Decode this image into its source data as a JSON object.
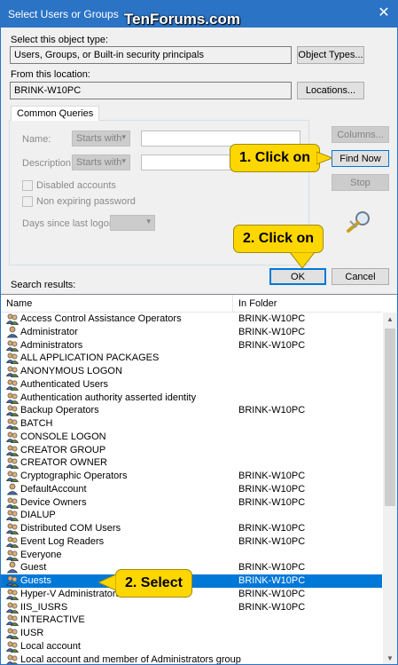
{
  "window": {
    "title": "Select Users or Groups",
    "watermark": "TenForums.com",
    "close_glyph": "✕"
  },
  "object_type": {
    "label": "Select this object type:",
    "value": "Users, Groups, or Built-in security principals",
    "button": "Object Types..."
  },
  "location": {
    "label": "From this location:",
    "value": "BRINK-W10PC",
    "button": "Locations..."
  },
  "queries": {
    "tab": "Common Queries",
    "name_label": "Name:",
    "name_mode": "Starts with",
    "description_label": "Description:",
    "description_mode": "Starts with",
    "disabled_accounts": "Disabled accounts",
    "non_expiring_password": "Non expiring password",
    "days_label": "Days since last logon:"
  },
  "buttons": {
    "columns": "Columns...",
    "find_now": "Find Now",
    "stop": "Stop",
    "ok": "OK",
    "cancel": "Cancel"
  },
  "callouts": {
    "find_now": "1. Click on",
    "ok": "2. Click on",
    "select": "2. Select"
  },
  "results": {
    "label": "Search results:",
    "columns": {
      "name": "Name",
      "folder": "In Folder"
    },
    "rows": [
      {
        "name": "Access Control Assistance Operators",
        "folder": "BRINK-W10PC",
        "icon": "group-icon"
      },
      {
        "name": "Administrator",
        "folder": "BRINK-W10PC",
        "icon": "user-icon"
      },
      {
        "name": "Administrators",
        "folder": "BRINK-W10PC",
        "icon": "group-icon"
      },
      {
        "name": "ALL APPLICATION PACKAGES",
        "folder": "",
        "icon": "group-icon"
      },
      {
        "name": "ANONYMOUS LOGON",
        "folder": "",
        "icon": "group-icon"
      },
      {
        "name": "Authenticated Users",
        "folder": "",
        "icon": "group-icon"
      },
      {
        "name": "Authentication authority asserted identity",
        "folder": "",
        "icon": "group-icon"
      },
      {
        "name": "Backup Operators",
        "folder": "BRINK-W10PC",
        "icon": "group-icon"
      },
      {
        "name": "BATCH",
        "folder": "",
        "icon": "group-icon"
      },
      {
        "name": "CONSOLE LOGON",
        "folder": "",
        "icon": "group-icon"
      },
      {
        "name": "CREATOR GROUP",
        "folder": "",
        "icon": "group-icon"
      },
      {
        "name": "CREATOR OWNER",
        "folder": "",
        "icon": "group-icon"
      },
      {
        "name": "Cryptographic Operators",
        "folder": "BRINK-W10PC",
        "icon": "group-icon"
      },
      {
        "name": "DefaultAccount",
        "folder": "BRINK-W10PC",
        "icon": "user-icon"
      },
      {
        "name": "Device Owners",
        "folder": "BRINK-W10PC",
        "icon": "group-icon"
      },
      {
        "name": "DIALUP",
        "folder": "",
        "icon": "group-icon"
      },
      {
        "name": "Distributed COM Users",
        "folder": "BRINK-W10PC",
        "icon": "group-icon"
      },
      {
        "name": "Event Log Readers",
        "folder": "BRINK-W10PC",
        "icon": "group-icon"
      },
      {
        "name": "Everyone",
        "folder": "",
        "icon": "group-icon"
      },
      {
        "name": "Guest",
        "folder": "BRINK-W10PC",
        "icon": "user-icon"
      },
      {
        "name": "Guests",
        "folder": "BRINK-W10PC",
        "icon": "group-icon",
        "selected": true
      },
      {
        "name": "Hyper-V Administrators",
        "folder": "BRINK-W10PC",
        "icon": "group-icon"
      },
      {
        "name": "IIS_IUSRS",
        "folder": "BRINK-W10PC",
        "icon": "group-icon"
      },
      {
        "name": "INTERACTIVE",
        "folder": "",
        "icon": "group-icon"
      },
      {
        "name": "IUSR",
        "folder": "",
        "icon": "group-icon"
      },
      {
        "name": "Local account",
        "folder": "",
        "icon": "group-icon"
      },
      {
        "name": "Local account and member of Administrators group",
        "folder": "",
        "icon": "group-icon"
      }
    ]
  },
  "colors": {
    "titlebar": "#2b73c5",
    "selection": "#0078d7",
    "callout": "#ffd700"
  }
}
